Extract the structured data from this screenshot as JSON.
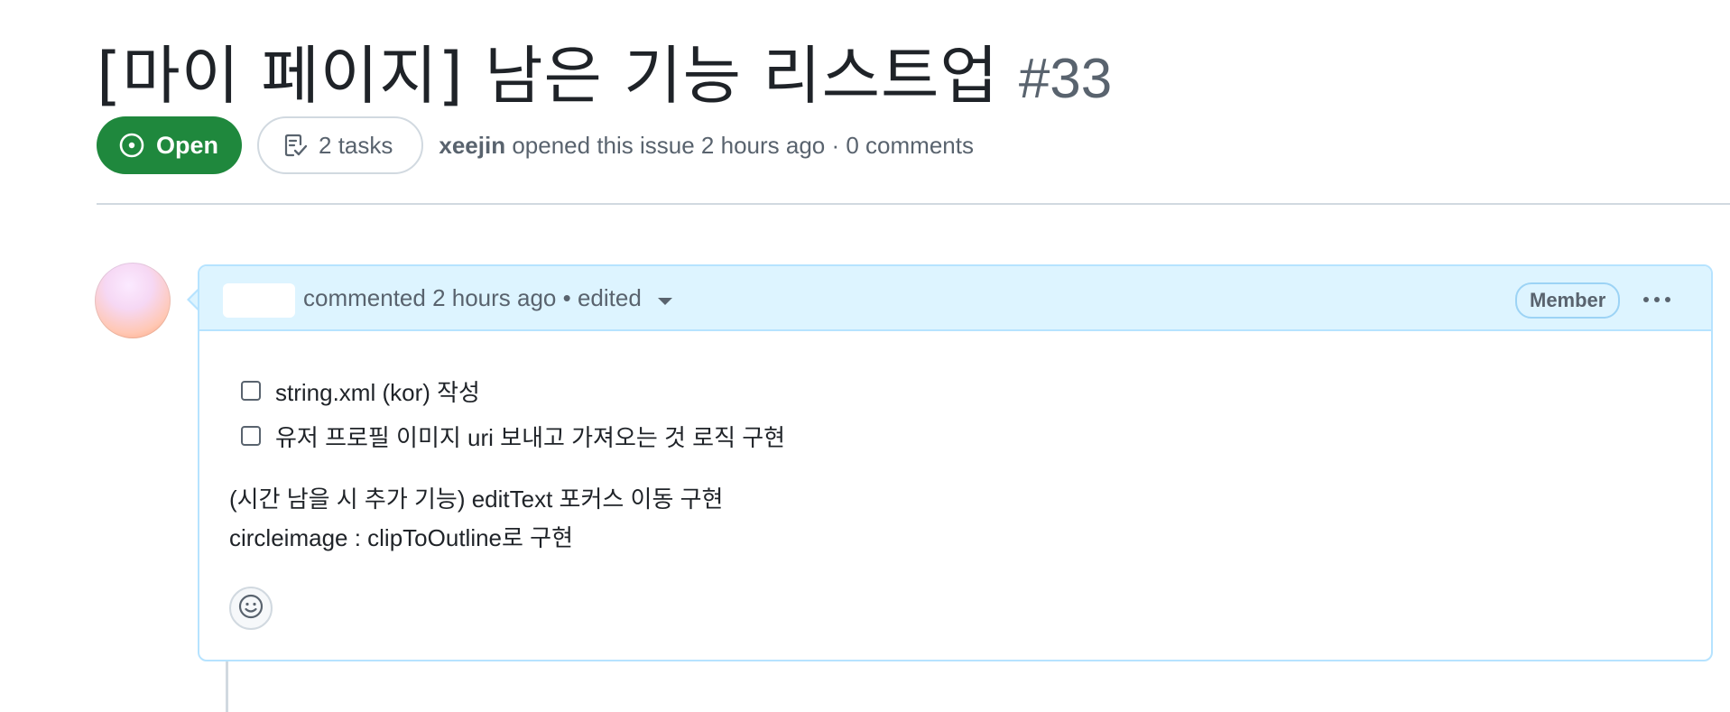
{
  "issue": {
    "title": "[마이 페이지] 남은 기능 리스트업",
    "number": "#33",
    "state": "Open",
    "tasks": "2 tasks",
    "author": "xeejin",
    "opened_text": "opened this issue 2 hours ago · 0 comments"
  },
  "comment": {
    "meta": "commented 2 hours ago • edited",
    "role_badge": "Member",
    "tasks": [
      {
        "label": "string.xml (kor) 작성",
        "checked": false
      },
      {
        "label": "유저 프로필 이미지 uri 보내고 가져오는 것 로직 구현",
        "checked": false
      }
    ],
    "body_lines": [
      "(시간 남을 시 추가 기능) editText 포커스 이동 구현",
      "circleimage : clipToOutline로 구현"
    ]
  },
  "colors": {
    "open_green": "#1f883d",
    "header_blue": "#ddf4ff",
    "border_blue": "#b6e3ff",
    "muted_text": "#59636e"
  },
  "icons": {
    "state": "issue-opened-icon",
    "tasks": "checklist-icon",
    "menu": "kebab-horizontal-icon",
    "reaction": "smiley-icon"
  }
}
